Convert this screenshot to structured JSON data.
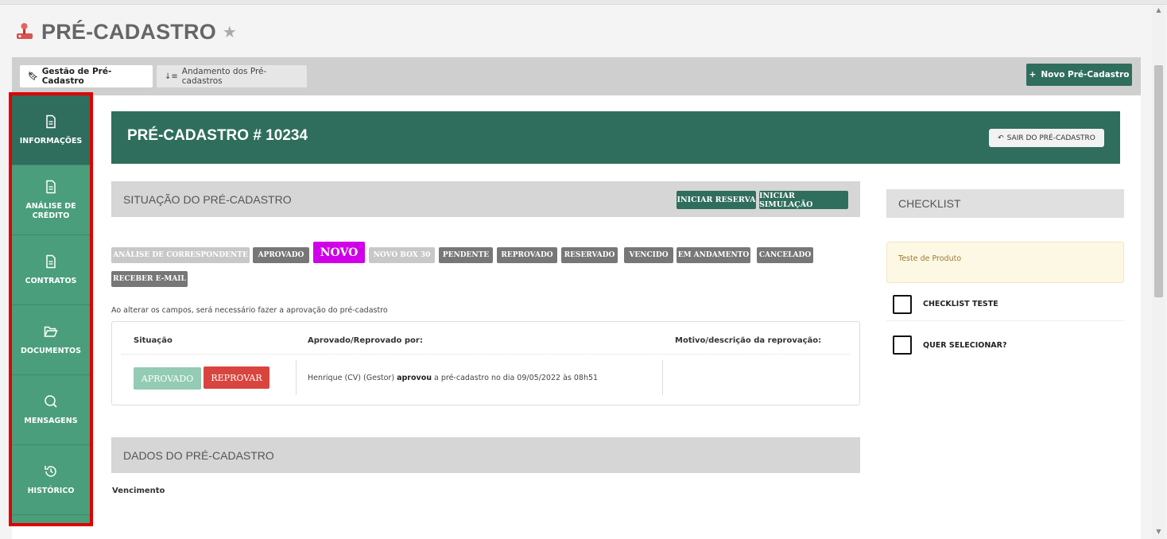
{
  "page": {
    "title": "PRÉ-CADASTRO",
    "logo_icon": "joystick-icon",
    "favorite_icon": "star-icon"
  },
  "tabs": [
    {
      "label": "Gestão de Pré-Cadastro",
      "icon": "bookmark-icon",
      "active": true
    },
    {
      "label": "Andamento dos Pré-cadastros",
      "icon": "sort-icon",
      "active": false
    }
  ],
  "actions": {
    "new_label": "Novo Pré-Cadastro"
  },
  "sidebar": {
    "items": [
      {
        "label": "INFORMAÇÕES",
        "icon": "document-icon",
        "active": true
      },
      {
        "label": "ANÁLISE DE CRÉDITO",
        "icon": "document-icon",
        "active": false
      },
      {
        "label": "CONTRATOS",
        "icon": "document-icon",
        "active": false
      },
      {
        "label": "DOCUMENTOS",
        "icon": "folder-open-icon",
        "active": false
      },
      {
        "label": "MENSAGENS",
        "icon": "chat-search-icon",
        "active": false
      },
      {
        "label": "HISTÓRICO",
        "icon": "history-icon",
        "active": false
      }
    ],
    "highlight_color": "#e00000"
  },
  "hero": {
    "title": "PRÉ-CADASTRO # 10234",
    "exit_label": "SAIR DO PRÉ-CADASTRO"
  },
  "situacao": {
    "title": "SITUAÇÃO DO PRÉ-CADASTRO",
    "buttons": [
      "INICIAR RESERVA",
      "INICIAR SIMULAÇÃO"
    ],
    "badges": [
      "ANÁLISE DE CORRESPONDENTE",
      "APROVADO",
      "NOVO",
      "NOVO BOX 30",
      "PENDENTE",
      "REPROVADO",
      "RESERVADO",
      "VENCIDO",
      "EM ANDAMENTO",
      "CANCELADO",
      "RECEBER E-MAIL"
    ],
    "note": "Ao alterar os campos, será necessário fazer a aprovação do pré-cadastro",
    "table": {
      "headers": [
        "Situação",
        "Aprovado/Reprovado por:",
        "Motivo/descrição da reprovação:"
      ],
      "approve_label": "APROVADO",
      "reject_label": "REPROVAR",
      "approval_pre": "Henrique (CV) (Gestor) ",
      "approval_bold": "aprovou",
      "approval_post": " a pré-cadastro no dia 09/05/2022 às 08h51",
      "motivo": ""
    }
  },
  "dados": {
    "title": "DADOS DO PRÉ-CADASTRO",
    "field_label": "Vencimento"
  },
  "checklist": {
    "title": "CHECKLIST",
    "alert": "Teste de Produto",
    "items": [
      "CHECKLIST TESTE",
      "QUER SELECIONAR?"
    ]
  },
  "colors": {
    "primary": "#2f6e5c",
    "sidebar": "#4a9e7b",
    "danger": "#d9453e",
    "novo": "#d000e8"
  }
}
